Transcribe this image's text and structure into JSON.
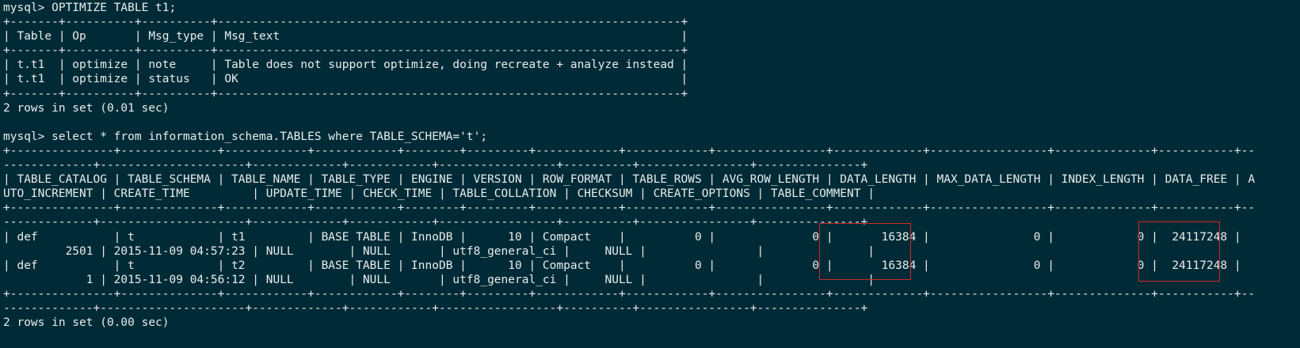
{
  "terminal": {
    "lines": [
      "mysql> OPTIMIZE TABLE t1;",
      "+-------+----------+----------+-------------------------------------------------------------------+",
      "| Table | Op       | Msg_type | Msg_text                                                          |",
      "+-------+----------+----------+-------------------------------------------------------------------+",
      "| t.t1  | optimize | note     | Table does not support optimize, doing recreate + analyze instead |",
      "| t.t1  | optimize | status   | OK                                                                |",
      "+-------+----------+----------+-------------------------------------------------------------------+",
      "2 rows in set (0.01 sec)",
      "",
      "mysql> select * from information_schema.TABLES where TABLE_SCHEMA='t';",
      "+---------------+--------------+------------+------------+--------+---------+------------+------------+----------------+-------------+-----------------+--------------+-----------+--",
      "-------------+---------------------+-------------+------------+-----------------+----------+----------------+---------------+",
      "| TABLE_CATALOG | TABLE_SCHEMA | TABLE_NAME | TABLE_TYPE | ENGINE | VERSION | ROW_FORMAT | TABLE_ROWS | AVG_ROW_LENGTH | DATA_LENGTH | MAX_DATA_LENGTH | INDEX_LENGTH | DATA_FREE | A",
      "UTO_INCREMENT | CREATE_TIME         | UPDATE_TIME | CHECK_TIME | TABLE_COLLATION | CHECKSUM | CREATE_OPTIONS | TABLE_COMMENT |",
      "+---------------+--------------+------------+------------+--------+---------+------------+------------+----------------+-------------+-----------------+--------------+-----------+--",
      "-------------+---------------------+-------------+------------+-----------------+----------+----------------+---------------+",
      "| def           | t            | t1         | BASE TABLE | InnoDB |      10 | Compact    |          0 |              0 |       16384 |               0 |            0 |  24117248 |",
      "         2501 | 2015-11-09 04:57:23 | NULL        | NULL       | utf8_general_ci |     NULL |                |               |",
      "| def           | t            | t2         | BASE TABLE | InnoDB |      10 | Compact    |          0 |              0 |       16384 |               0 |            0 |  24117248 |",
      "            1 | 2015-11-09 04:56:12 | NULL        | NULL       | utf8_general_ci |     NULL |                |               |",
      "+---------------+--------------+------------+------------+--------+---------+------------+------------+----------------+-------------+-----------------+--------------+-----------+--",
      "-------------+---------------------+-------------+------------+-----------------+----------+----------------+---------------+",
      "2 rows in set (0.00 sec)"
    ]
  },
  "highlights": [
    {
      "label": "DATA_LENGTH",
      "color": "#c82a2a"
    },
    {
      "label": "DATA_FREE",
      "color": "#c82a2a"
    }
  ]
}
